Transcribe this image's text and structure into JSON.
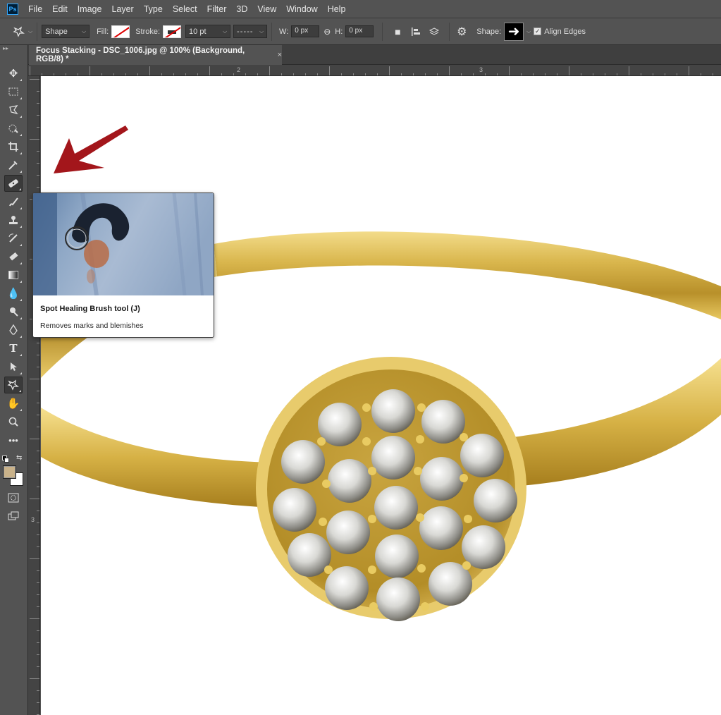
{
  "app": {
    "logo": "Ps",
    "menu": [
      "File",
      "Edit",
      "Image",
      "Layer",
      "Type",
      "Select",
      "Filter",
      "3D",
      "View",
      "Window",
      "Help"
    ]
  },
  "options_bar": {
    "mode": "Shape",
    "fill_label": "Fill:",
    "stroke_label": "Stroke:",
    "stroke_width": "10 pt",
    "w_label": "W:",
    "w_value": "0 px",
    "h_label": "H:",
    "h_value": "0 px",
    "shape_label": "Shape:",
    "align_edges_label": "Align Edges",
    "align_edges_checked": true
  },
  "document_tab": {
    "title": "Focus Stacking - DSC_1006.jpg @ 100% (Background, RGB/8) *",
    "close": "×"
  },
  "rulers": {
    "top_labels": [
      "2",
      "3"
    ],
    "left_labels": [
      "3"
    ]
  },
  "toolbar": {
    "tools": [
      "move-icon",
      "marquee-icon",
      "lasso-icon",
      "quick-select-icon",
      "crop-icon",
      "eyedropper-icon",
      "spot-healing-icon",
      "brush-icon",
      "stamp-icon",
      "history-brush-icon",
      "eraser-icon",
      "gradient-icon",
      "blur-icon",
      "dodge-icon",
      "pen-icon",
      "type-icon",
      "path-select-icon",
      "custom-shape-icon",
      "hand-icon",
      "zoom-icon",
      "more-icon"
    ],
    "foreground_color": "#c9b28a",
    "background_color": "#ffffff"
  },
  "tooltip": {
    "title": "Spot Healing Brush tool (J)",
    "description": "Removes marks and blemishes"
  },
  "colors": {
    "annotation_arrow": "#a3161b",
    "ring_gold": "#d8b54a"
  }
}
